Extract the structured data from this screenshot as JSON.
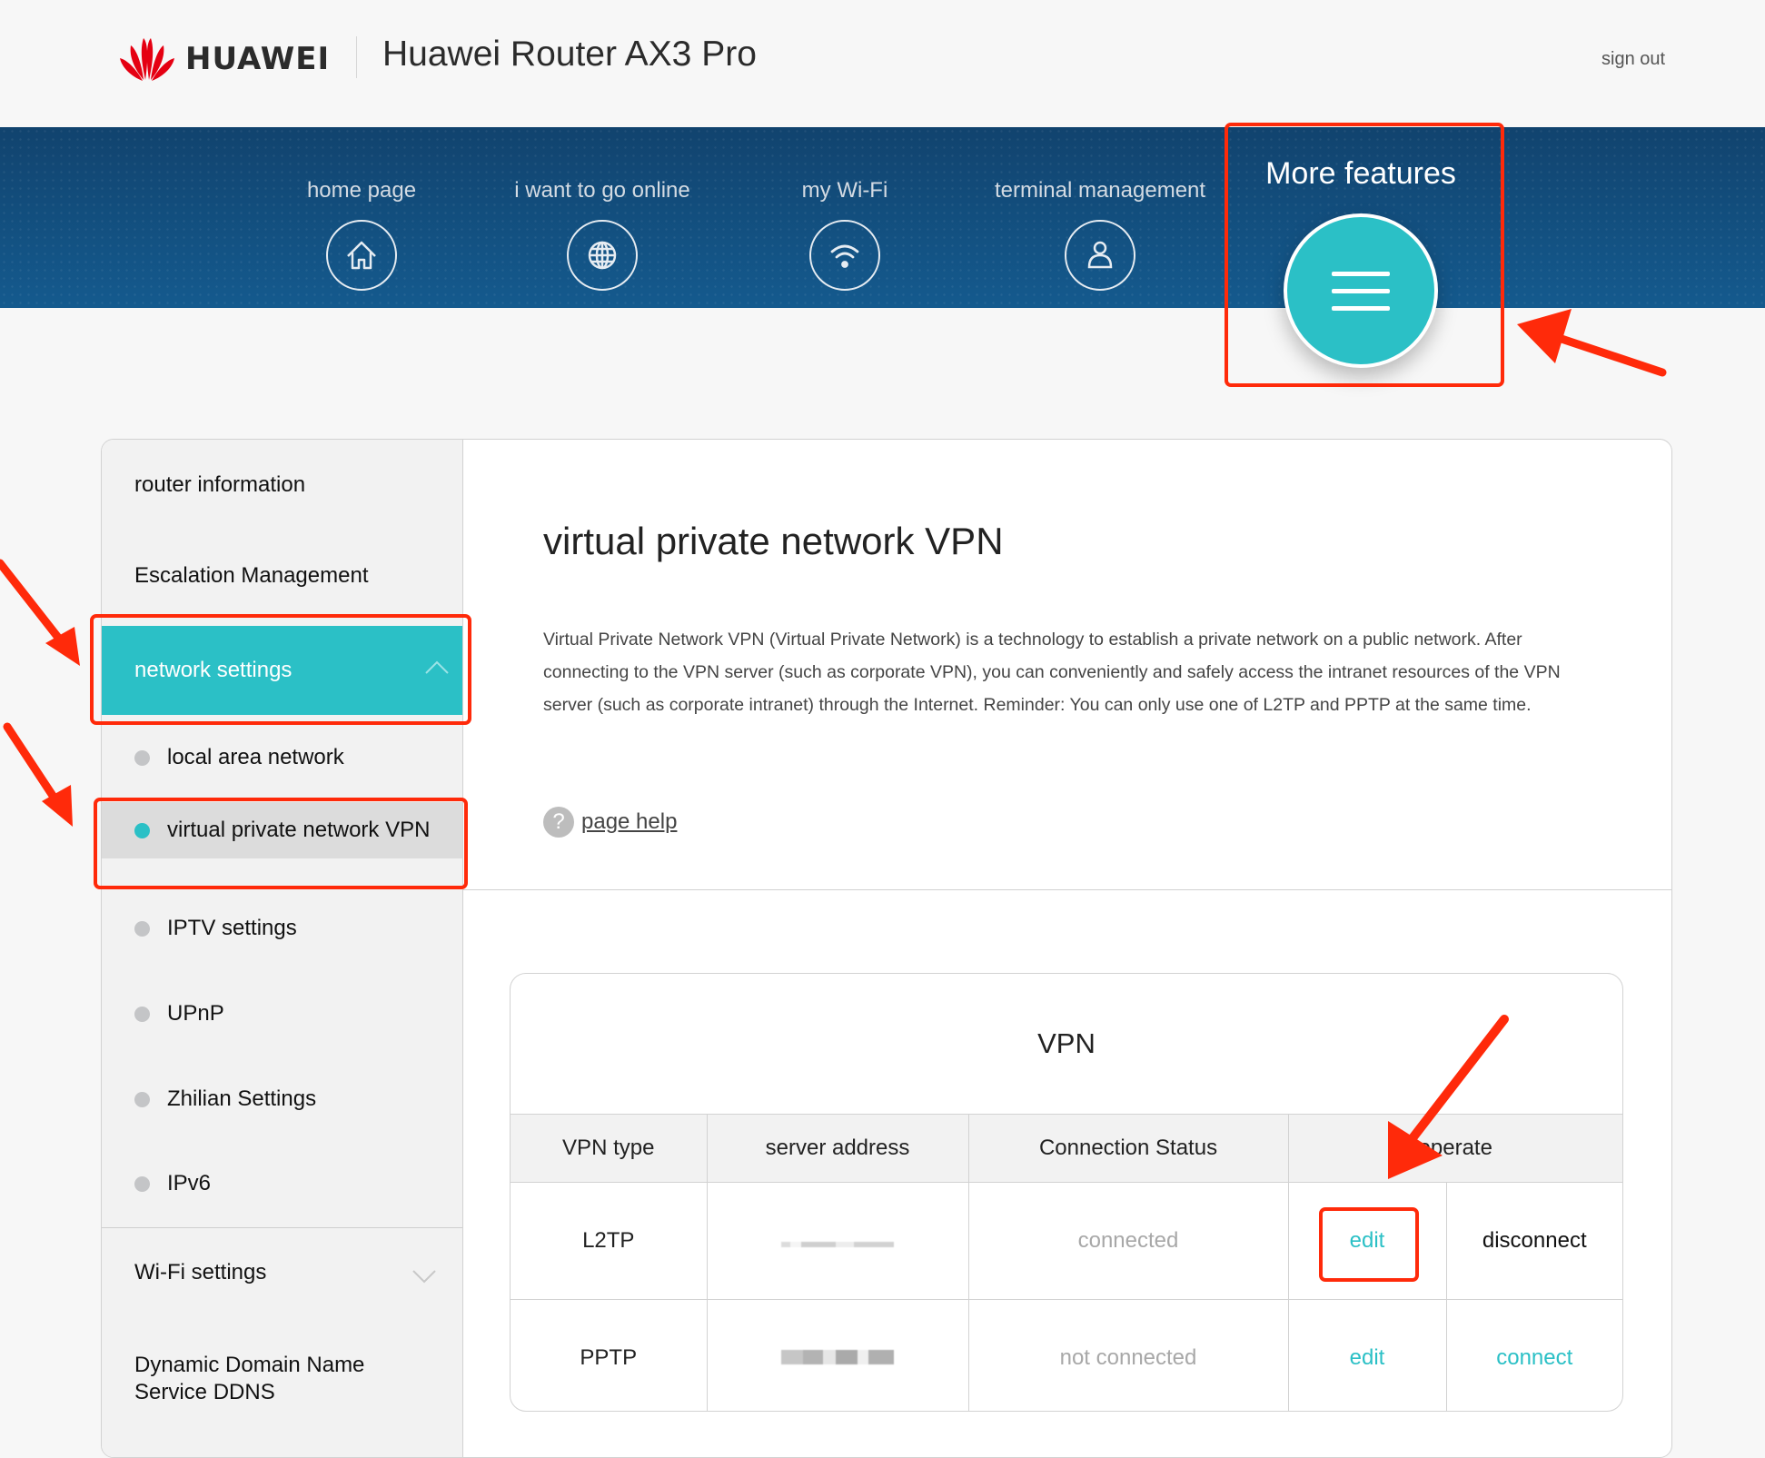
{
  "header": {
    "brand": "HUAWEI",
    "app_title": "Huawei Router AX3 Pro",
    "sign_out": "sign out"
  },
  "nav": {
    "items": [
      {
        "label": "home page",
        "icon": "home-icon"
      },
      {
        "label": "i want to go online",
        "icon": "globe-icon"
      },
      {
        "label": "my Wi-Fi",
        "icon": "wifi-icon"
      },
      {
        "label": "terminal management",
        "icon": "user-icon"
      }
    ],
    "more": {
      "label": "More features",
      "icon": "menu-icon"
    }
  },
  "sidebar": {
    "router_information": "router information",
    "escalation_management": "Escalation Management",
    "network_settings": {
      "label": "network settings",
      "expanded": true,
      "children": [
        {
          "label": "local area network",
          "active": false
        },
        {
          "label": "virtual private network VPN",
          "active": true
        },
        {
          "label": "IPTV settings",
          "active": false
        },
        {
          "label": "UPnP",
          "active": false
        },
        {
          "label": "Zhilian Settings",
          "active": false
        },
        {
          "label": "IPv6",
          "active": false
        }
      ]
    },
    "wifi_settings": {
      "label": "Wi-Fi settings",
      "expanded": false
    },
    "ddns": {
      "line1": "Dynamic Domain Name",
      "line2": "Service DDNS"
    }
  },
  "content": {
    "title": "virtual private network VPN",
    "description": "Virtual Private Network VPN (Virtual Private Network) is a technology to establish a private network on a public network. After connecting to the VPN server (such as corporate VPN), you can conveniently and safely access the intranet resources of the VPN server (such as corporate intranet) through the Internet. Reminder: You can only use one of L2TP and PPTP at the same time.",
    "page_help": "page help"
  },
  "vpn_table": {
    "title": "VPN",
    "columns": [
      "VPN type",
      "server address",
      "Connection Status",
      "operate"
    ],
    "rows": [
      {
        "type": "L2TP",
        "server_address": "[redacted]",
        "status": "connected",
        "edit": "edit",
        "action": "disconnect"
      },
      {
        "type": "PPTP",
        "server_address": "[redacted]",
        "status": "not connected",
        "edit": "edit",
        "action": "connect"
      }
    ]
  },
  "colors": {
    "accent": "#2bc0c6",
    "band_top": "#11436e",
    "band_bottom": "#145a8e",
    "annotation_red": "#ff2a0a",
    "brand_red": "#e50012"
  }
}
